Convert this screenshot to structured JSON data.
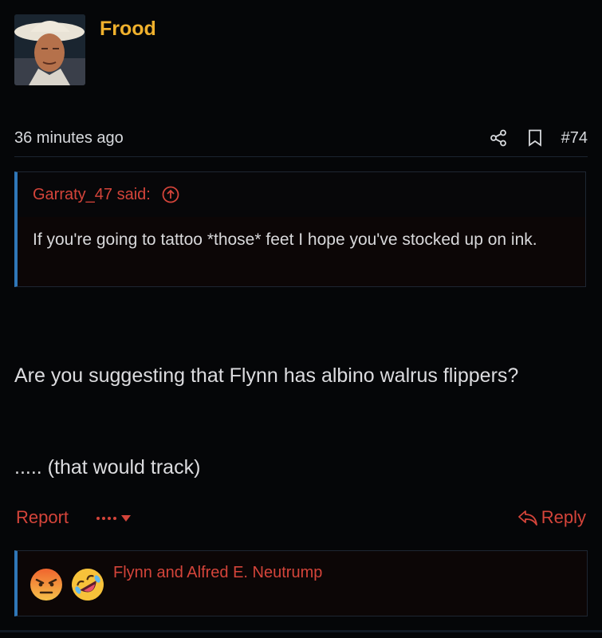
{
  "post": {
    "author": "Frood",
    "timestamp": "36 minutes ago",
    "post_number": "#74",
    "icons": {
      "share": "share-icon",
      "bookmark": "bookmark-icon"
    }
  },
  "quote": {
    "attribution": "Garraty_47 said:",
    "attribution_icon": "circle-up-arrow-icon",
    "text": "If you're going to tattoo *those* feet I hope you've stocked up on ink."
  },
  "message": {
    "line1": "Are you suggesting that Flynn has albino walrus flippers?",
    "line2": "..... (that would track)"
  },
  "actions": {
    "report_label": "Report",
    "more_icon": "ellipsis-dropdown-icon",
    "reply_label": "Reply",
    "reply_icon": "reply-arrow-icon"
  },
  "reactions": {
    "emojis": [
      "angry-emoji",
      "rofl-emoji"
    ],
    "reactors": "Flynn and Alfred E. Neutrump"
  },
  "colors": {
    "username": "#f0b12d",
    "accent_red": "#d4443a",
    "quote_border": "#2f77b8",
    "background": "#050608"
  }
}
